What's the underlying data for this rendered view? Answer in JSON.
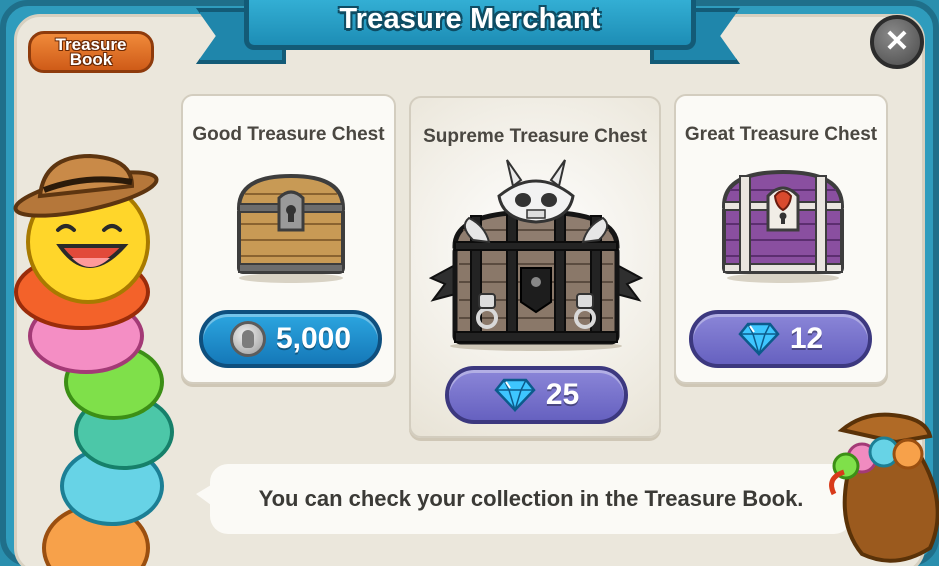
{
  "header": {
    "title": "Treasure Merchant"
  },
  "treasure_book_button": {
    "label": "Treasure Book"
  },
  "close_button": {
    "icon": "close-icon"
  },
  "chests": [
    {
      "name": "Good Treasure Chest",
      "price": "5,000",
      "currency_icon": "coin-icon",
      "button_color": "#1d8fcc"
    },
    {
      "name": "Supreme Treasure Chest",
      "price": "25",
      "currency_icon": "gem-icon",
      "button_color": "#7570cc"
    },
    {
      "name": "Great Treasure Chest",
      "price": "12",
      "currency_icon": "gem-icon",
      "button_color": "#7570cc"
    }
  ],
  "message": "You can check your collection in the Treasure Book.",
  "colors": {
    "frame": "#2f9cbd",
    "panel": "#ebe7dc",
    "ribbon": "#1d8db5",
    "book_button": "#e3772c"
  }
}
